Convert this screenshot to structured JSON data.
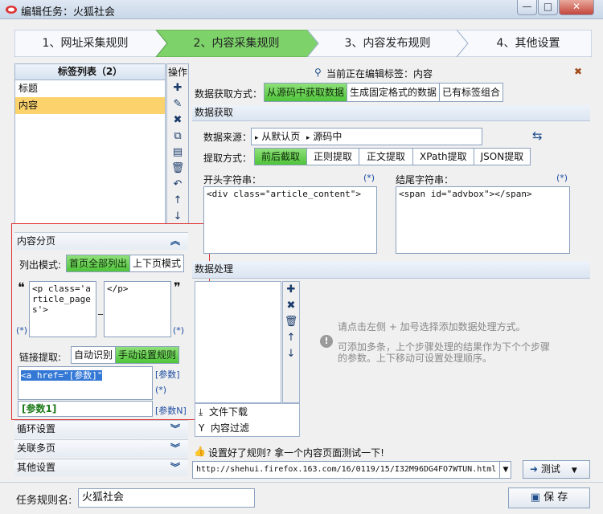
{
  "app": {
    "title": "编辑任务：火狐社会",
    "min": "—",
    "max": "□",
    "close": "✕"
  },
  "steps": [
    {
      "label": "1、网址采集规则"
    },
    {
      "label": "2、内容采集规则"
    },
    {
      "label": "3、内容发布规则"
    },
    {
      "label": "4、其他设置"
    }
  ],
  "colors": {
    "active_step": "#7dd36a",
    "selected_tag": "#fbd26b",
    "red_outline": "#e03030",
    "step_bg": "#f7f9fc"
  },
  "tags": {
    "header": "标签列表（2）",
    "items": [
      "标题",
      "内容"
    ],
    "ops_title": "操作"
  },
  "paging": {
    "title": "内容分页",
    "list_label": "列出模式:",
    "list_modes": [
      "首页全部列出",
      "上下页模式"
    ],
    "start_text": "<p class='article_pages'>",
    "end_text": "</p>",
    "dash": "_",
    "star": "(*)",
    "link_label": "链接提取:",
    "link_modes": [
      "自动识别",
      "手动设置规则"
    ],
    "link_rule": "<a href=\"[参数]\"",
    "result": "[参数1]",
    "param": "[参数]",
    "star2": "(*)",
    "paramN": "[参数N]"
  },
  "sections": [
    "循环设置",
    "关联多页",
    "其他设置"
  ],
  "editing": {
    "text": "当前正在编辑标签：内容",
    "close": "✖"
  },
  "fetch_mode": {
    "label": "数据获取方式：",
    "options": [
      "从源码中获取数据",
      "生成固定格式的数据",
      "已有标签组合"
    ]
  },
  "data_fetch": {
    "title": "数据获取",
    "source_label": "数据来源：",
    "source_a": "从默认页",
    "source_b": "源码中",
    "method_label": "提取方式：",
    "methods": [
      "前后截取",
      "正则提取",
      "正文提取",
      "XPath提取",
      "JSON提取"
    ],
    "start_label": "开头字符串：",
    "start_value": "<div class=\"article_content\">",
    "end_label": "结尾字符串：",
    "end_value": "<span id=\"advbox\"></span>",
    "star": "(*)"
  },
  "data_process": {
    "title": "数据处理",
    "items": [
      "文件下载",
      "内容过滤"
    ],
    "hint1": "请点击左侧 + 加号选择添加数据处理方式。",
    "hint2": "可添加多条，上个步骤处理的结果作为下个个步骤的参数。上下移动可设置处理顺序。"
  },
  "test": {
    "prompt": "设置好了规则? 拿一个内容页面测试一下!",
    "url": "http://shehui.firefox.163.com/16/0119/15/I32M96DG4FO7WTUN.html",
    "button": "测试"
  },
  "footer": {
    "name_label": "任务规则名:",
    "name_value": "火狐社会",
    "save": "保 存"
  }
}
